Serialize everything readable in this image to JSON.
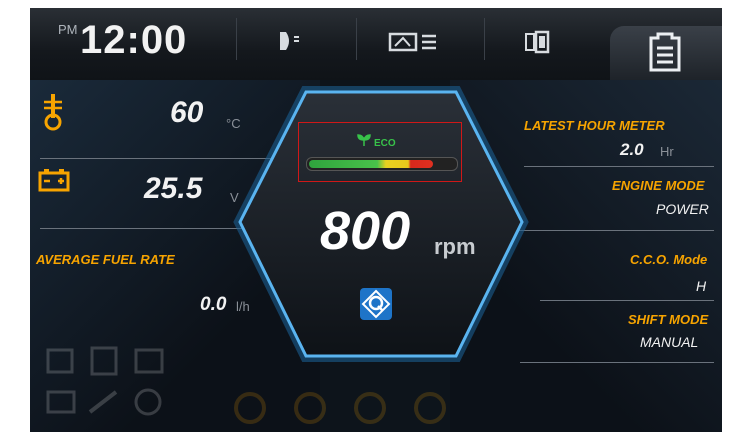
{
  "status_bar": {
    "period": "PM",
    "time": "12:00",
    "icons": [
      "headlight-icon",
      "dashboard-list-icon",
      "camera-view-icon",
      "document-icon"
    ]
  },
  "left_panel": {
    "coolant": {
      "icon": "coolant-temperature-icon",
      "value": "60",
      "unit": "°C"
    },
    "battery": {
      "icon": "battery-icon",
      "value": "25.5",
      "unit": "V"
    },
    "fuel": {
      "label": "AVERAGE FUEL RATE",
      "value": "0.0",
      "unit": "l/h"
    }
  },
  "center_gauge": {
    "eco_label": "ECO",
    "eco_level": 0.85,
    "rpm_value": "800",
    "rpm_unit": "rpm",
    "mode_icon": "quick-mode-icon"
  },
  "right_panel": {
    "hour_meter": {
      "label": "LATEST HOUR METER",
      "value": "2.0",
      "unit": "Hr"
    },
    "engine_mode": {
      "label": "ENGINE MODE",
      "value": "POWER"
    },
    "cco_mode": {
      "label": "C.C.O. Mode",
      "value": "H"
    },
    "shift_mode": {
      "label": "SHIFT MODE",
      "value": "MANUAL"
    }
  },
  "colors": {
    "accent_orange": "#f7a400",
    "hex_border": "#4aa6e6",
    "eco_green": "#38c24a"
  }
}
